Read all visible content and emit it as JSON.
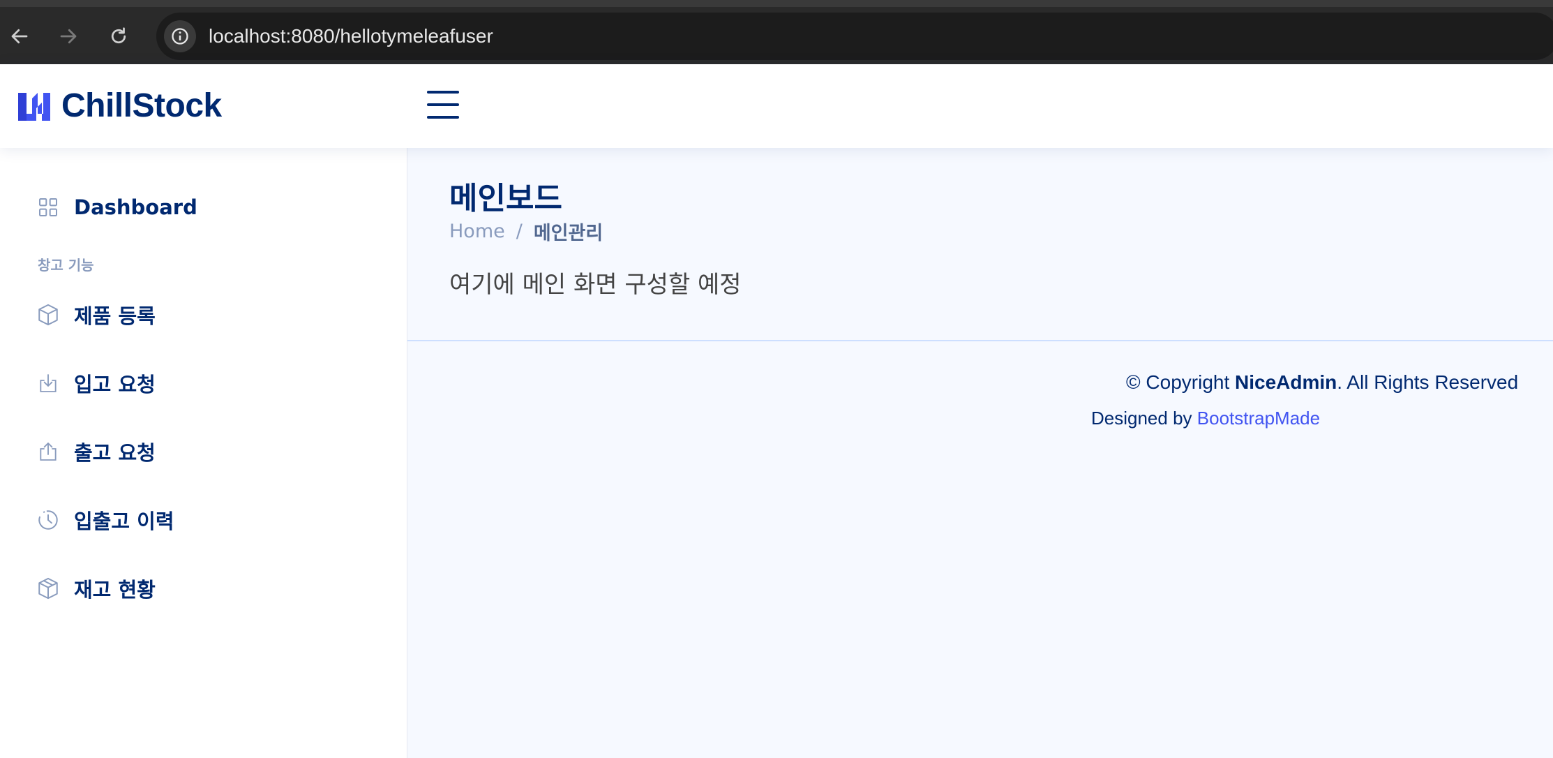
{
  "browser": {
    "url": "localhost:8080/hellotymeleafuser"
  },
  "header": {
    "logo_text": "ChillStock"
  },
  "sidebar": {
    "items": [
      {
        "label": "Dashboard",
        "icon": "grid-icon"
      },
      {
        "label": "제품 등록",
        "icon": "box-icon"
      },
      {
        "label": "입고 요청",
        "icon": "download-icon"
      },
      {
        "label": "출고 요청",
        "icon": "upload-icon"
      },
      {
        "label": "입출고 이력",
        "icon": "clock-icon"
      },
      {
        "label": "재고 현황",
        "icon": "box-icon"
      }
    ],
    "heading": "창고 기능"
  },
  "main": {
    "title": "메인보드",
    "breadcrumb": {
      "home": "Home",
      "separator": "/",
      "current": "메인관리"
    },
    "content": "여기에 메인 화면 구성할 예정"
  },
  "footer": {
    "copyright_prefix": "© Copyright ",
    "copyright_brand": "NiceAdmin",
    "copyright_suffix": ". All Rights Reserved",
    "designed_by": "Designed by ",
    "designer": "BootstrapMade"
  },
  "colors": {
    "brand": "#012970",
    "accent": "#4154f1",
    "muted": "#899bbd"
  }
}
